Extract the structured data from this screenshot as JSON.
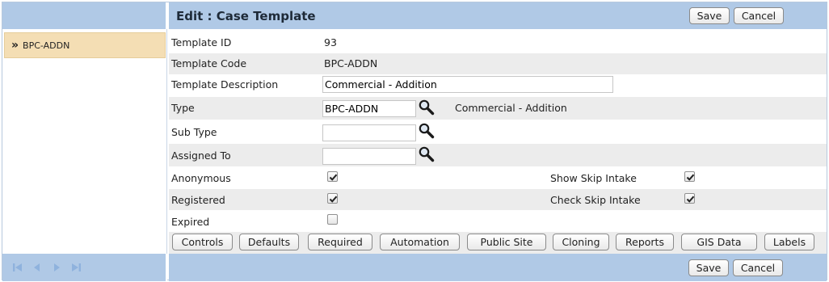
{
  "header": {
    "title": "Edit : Case Template",
    "save_label": "Save",
    "cancel_label": "Cancel"
  },
  "sidebar": {
    "items": [
      {
        "label": "BPC-ADDN"
      }
    ]
  },
  "form": {
    "template_id": {
      "label": "Template ID",
      "value": "93"
    },
    "template_code": {
      "label": "Template Code",
      "value": "BPC-ADDN"
    },
    "template_description": {
      "label": "Template Description",
      "value": "Commercial - Addition"
    },
    "type": {
      "label": "Type",
      "value": "BPC-ADDN",
      "description": "Commercial - Addition"
    },
    "sub_type": {
      "label": "Sub Type",
      "value": ""
    },
    "assigned_to": {
      "label": "Assigned To",
      "value": ""
    },
    "anonymous": {
      "label": "Anonymous",
      "checked": true
    },
    "registered": {
      "label": "Registered",
      "checked": true
    },
    "expired": {
      "label": "Expired",
      "checked": false
    },
    "show_skip_intake": {
      "label": "Show Skip Intake",
      "checked": true
    },
    "check_skip_intake": {
      "label": "Check Skip Intake",
      "checked": true
    }
  },
  "tabs": [
    {
      "label": "Controls"
    },
    {
      "label": "Defaults"
    },
    {
      "label": "Required"
    },
    {
      "label": "Automation"
    },
    {
      "label": "Public Site"
    },
    {
      "label": "Cloning"
    },
    {
      "label": "Reports"
    },
    {
      "label": "GIS Data"
    },
    {
      "label": "Labels"
    }
  ],
  "footer": {
    "save_label": "Save",
    "cancel_label": "Cancel",
    "nav_icons": [
      "first-page-icon",
      "previous-page-icon",
      "next-page-icon",
      "last-page-icon"
    ]
  },
  "colors": {
    "header_bg": "#b0c9e6",
    "selected_item_bg": "#f4deb4",
    "alt_row_bg": "#ececec",
    "nav_icon_disabled": "#8fb2dd"
  }
}
